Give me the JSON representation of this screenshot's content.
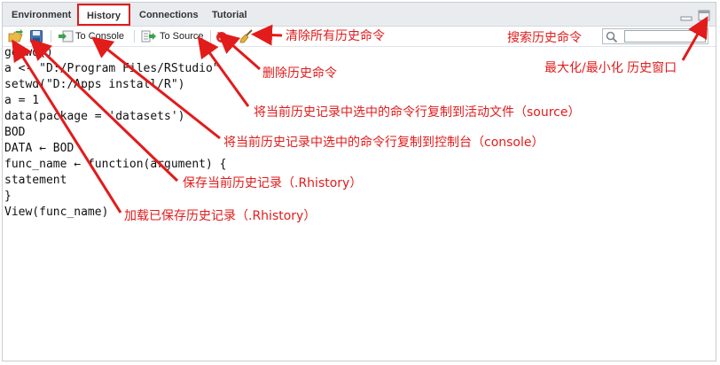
{
  "tabs": [
    "Environment",
    "History",
    "Connections",
    "Tutorial"
  ],
  "toolbar": {
    "to_console": "To Console",
    "to_source": "To Source"
  },
  "history_lines": [
    "getwd()",
    "a <- \"D:/Program Files/RStudio\"",
    "setwd(\"D:/Apps install/R\")",
    "a = 1",
    "data(package = 'datasets')",
    "BOD",
    "DATA ← BOD",
    "func_name ← function(argument) {",
    "statement",
    "}",
    "View(func_name)"
  ],
  "annotations": {
    "clear_all": "清除所有历史命令",
    "search": "搜索历史命令",
    "delete": "删除历史命令",
    "maximize": "最大化/最小化 历史窗口",
    "to_source": "将当前历史记录中选中的命令行复制到活动文件（source）",
    "to_console": "将当前历史记录中选中的命令行复制到控制台（console）",
    "save": "保存当前历史记录（.Rhistory）",
    "load": "加载已保存历史记录（.Rhistory）"
  },
  "colors": {
    "annotation": "#e21b1b",
    "tab_bar": "#e9ecef"
  }
}
